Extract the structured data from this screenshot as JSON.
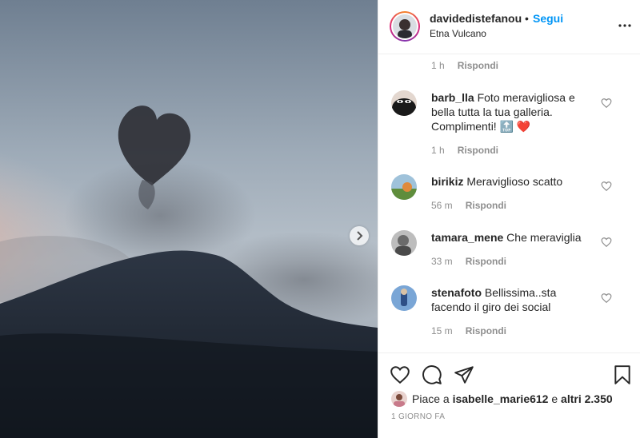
{
  "post": {
    "username": "davidedistefanou",
    "separator": "•",
    "follow_label": "Segui",
    "location": "Etna Vulcano",
    "more_icon": "more-horizontal-icon",
    "next_icon": "chevron-right-icon"
  },
  "top_meta": {
    "time": "1 h",
    "reply": "Rispondi"
  },
  "comments": [
    {
      "username": "barb_lla",
      "text": "Foto meravigliosa e bella tutta la tua galleria. Complimenti! 🔝 ❤️",
      "time": "1 h",
      "reply": "Rispondi"
    },
    {
      "username": "birikiz",
      "text": "Meraviglioso scatto",
      "time": "56 m",
      "reply": "Rispondi"
    },
    {
      "username": "tamara_mene",
      "text": "Che meraviglia",
      "time": "33 m",
      "reply": "Rispondi"
    },
    {
      "username": "stenafoto",
      "text": "Bellissima..sta facendo il giro dei social",
      "time": "15 m",
      "reply": "Rispondi"
    }
  ],
  "actions": {
    "like_icon": "heart-icon",
    "comment_icon": "comment-icon",
    "share_icon": "share-icon",
    "save_icon": "bookmark-icon",
    "likes_prefix": "Piace a",
    "likes_user": "isabelle_marie612",
    "likes_connector": "e",
    "likes_others": "altri 2.350",
    "date": "1 GIORNO FA"
  },
  "colors": {
    "link": "#0095f6",
    "meta": "#8e8e8e",
    "text": "#262626",
    "border": "#efefef"
  }
}
